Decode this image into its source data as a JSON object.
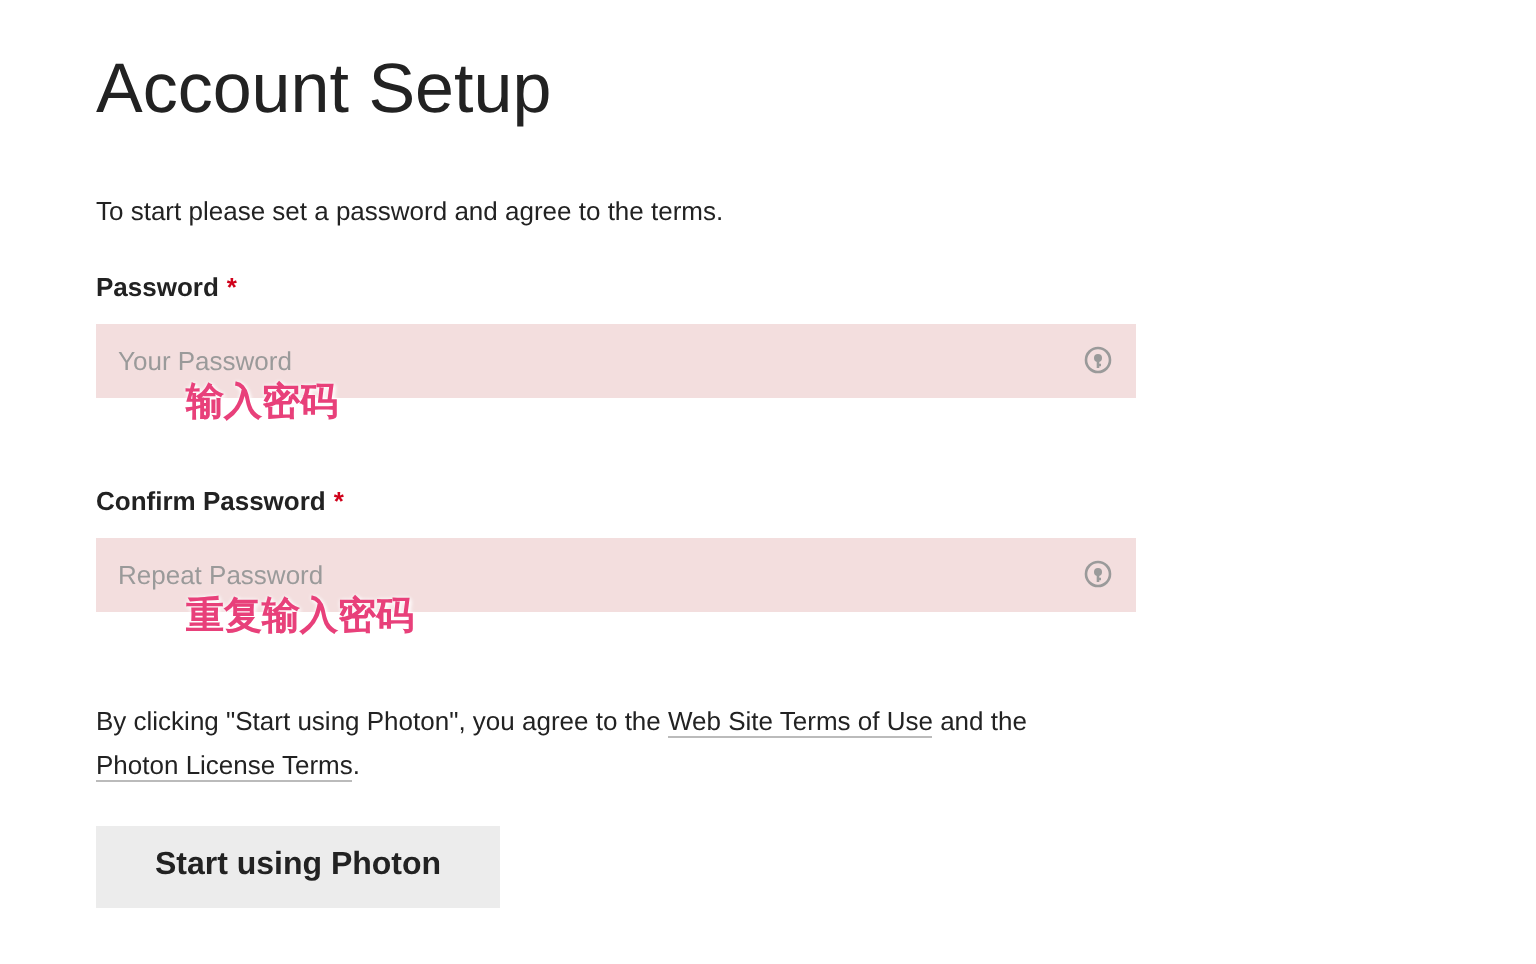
{
  "title": "Account Setup",
  "intro": "To start please set a password and agree to the terms.",
  "fields": [
    {
      "label": "Password",
      "required_mark": "*",
      "placeholder": "Your Password",
      "annotation": "输入密码"
    },
    {
      "label": "Confirm Password",
      "required_mark": "*",
      "placeholder": "Repeat Password",
      "annotation": "重复输入密码"
    }
  ],
  "terms": {
    "before": "By clicking \"Start using Photon\", you agree to the ",
    "link_1": "Web Site Terms of Use",
    "middle": " and the ",
    "link_2": "Photon License Terms",
    "after": "."
  },
  "button": "Start using Photon"
}
